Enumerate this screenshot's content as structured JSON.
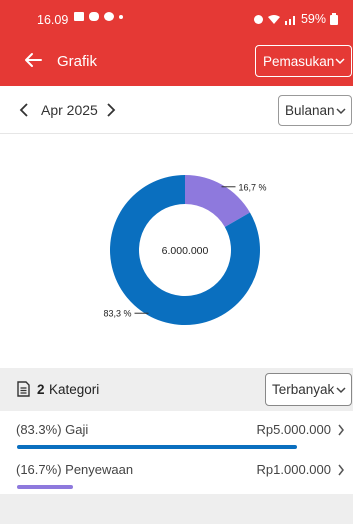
{
  "status_bar": {
    "time": "16.09",
    "battery": "59%"
  },
  "app_bar": {
    "title": "Grafik",
    "type_select": "Pemasukan"
  },
  "period": {
    "label": "Apr 2025",
    "interval": "Bulanan"
  },
  "chart_data": {
    "type": "pie",
    "style": "donut",
    "center_label": "6.000.000",
    "slices": [
      {
        "category": "Gaji",
        "value": 5000000,
        "percent_label": "83,3 %",
        "color": "#0a6fbf"
      },
      {
        "category": "Penyewaan",
        "value": 1000000,
        "percent_label": "16,7 %",
        "color": "#8e79dd"
      }
    ]
  },
  "summary": {
    "count": "2",
    "label": "Kategori",
    "sort": "Terbanyak"
  },
  "categories": [
    {
      "percent": "(83.3%)",
      "name": "Gaji",
      "amount": "Rp5.000.000",
      "share": 0.833,
      "color": "#0a6fbf"
    },
    {
      "percent": "(16.7%)",
      "name": "Penyewaan",
      "amount": "Rp1.000.000",
      "share": 0.167,
      "color": "#8e79dd"
    }
  ],
  "icons": {
    "back": "arrow-left-icon",
    "prev": "chevron-left-icon",
    "next": "chevron-right-icon",
    "dropdown": "chevron-down-icon",
    "document": "document-icon",
    "row_arrow": "chevron-right-icon"
  },
  "colors": {
    "header": "#e53935",
    "income_primary": "#0a6fbf",
    "income_secondary": "#8e79dd"
  }
}
